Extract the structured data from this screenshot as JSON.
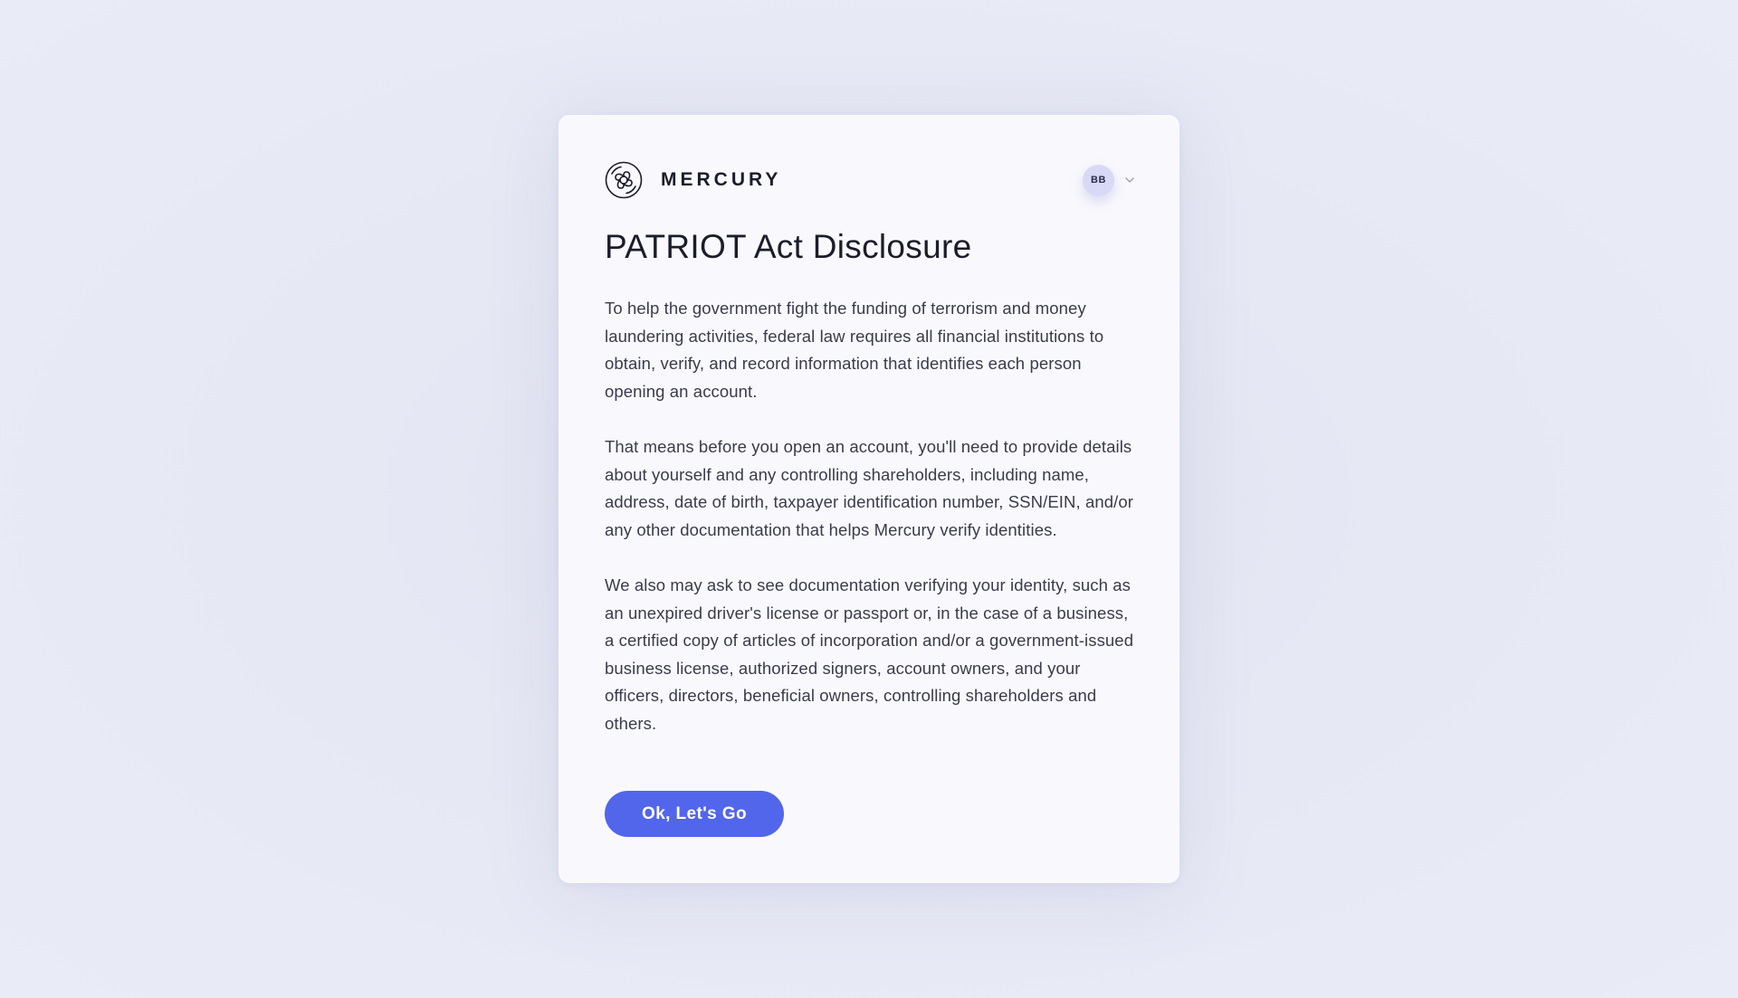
{
  "brand": {
    "name": "MERCURY",
    "logo_icon": "mercury-logo-icon"
  },
  "account": {
    "initials": "BB",
    "menu_icon": "chevron-down-icon"
  },
  "disclosure": {
    "title": "PATRIOT Act Disclosure",
    "paragraphs": [
      "To help the government fight the funding of terrorism and money laundering activities, federal law requires all financial institutions to obtain, verify, and record information that identifies each person opening an account.",
      "That means before you open an account, you'll need to provide details about yourself and any controlling shareholders, including name, address, date of birth, taxpayer identification number, SSN/EIN, and/or any other documentation that helps Mercury verify identities.",
      "We also may ask to see documentation verifying your identity, such as an unexpired driver's license or passport or, in the case of a business, a certified copy of articles of incorporation and/or a government-issued business license, authorized signers, account owners, and your officers, directors, beneficial owners, controlling shareholders and others."
    ],
    "button_label": "Ok, Let's Go"
  },
  "colors": {
    "background": "#e8eaf5",
    "card": "#f9f9fd",
    "primary": "#5266eb",
    "avatar": "#d8d9f6",
    "text": "#1c1d2a"
  }
}
